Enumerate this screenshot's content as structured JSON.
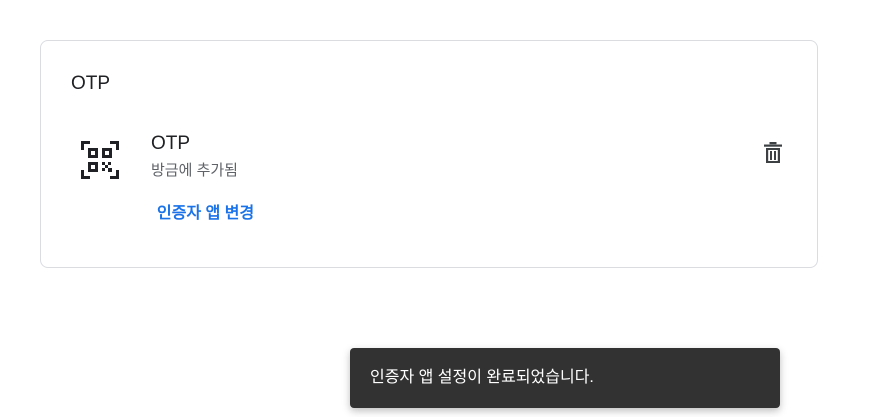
{
  "card": {
    "title": "OTP",
    "authenticator": {
      "name": "OTP",
      "added": "방금에 추가됨",
      "icon": "qr-code-icon",
      "change_label": "인증자 앱 변경",
      "delete_icon": "trash-icon"
    }
  },
  "toast": {
    "message": "인증자 앱 설정이 완료되었습니다."
  },
  "colors": {
    "link": "#1a73e8",
    "toast_bg": "#323232",
    "card_border": "#dadce0"
  }
}
